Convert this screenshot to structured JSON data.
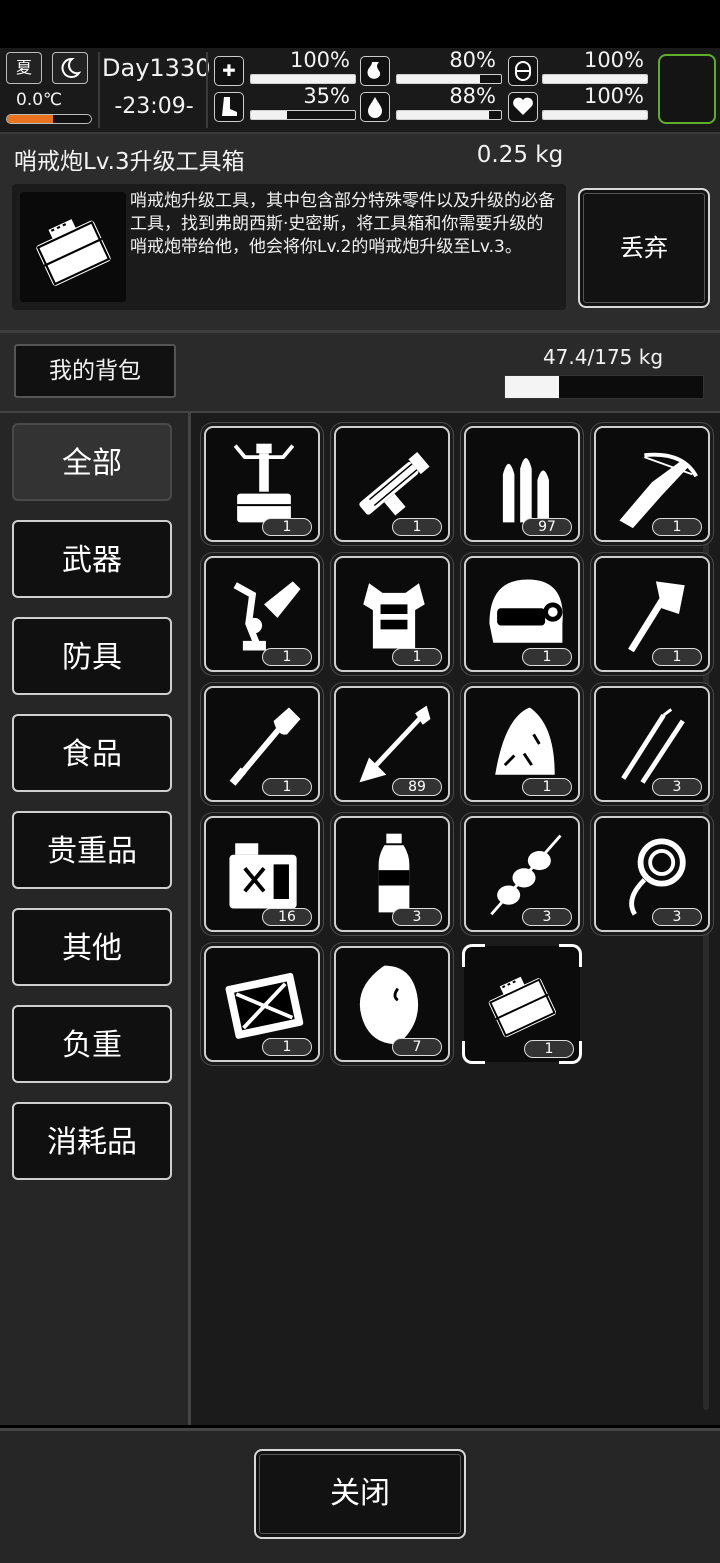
{
  "status": {
    "season": "夏",
    "temperature": "0.0℃",
    "temperature_level": 0.55,
    "day": "Day1330",
    "time": "-23:09-",
    "stats": [
      {
        "icon": "medkit-icon",
        "value": "100%",
        "level": 1.0
      },
      {
        "icon": "stomach-icon",
        "value": "80%",
        "level": 0.8
      },
      {
        "icon": "stamina-icon",
        "value": "100%",
        "level": 1.0
      },
      {
        "icon": "boot-icon",
        "value": "35%",
        "level": 0.35
      },
      {
        "icon": "water-drop-icon",
        "value": "88%",
        "level": 0.88
      },
      {
        "icon": "heart-icon",
        "value": "100%",
        "level": 1.0
      }
    ],
    "accent_color": "#5fae2a"
  },
  "detail": {
    "title": "哨戒炮Lv.3升级工具箱",
    "weight": "0.25 kg",
    "description": "哨戒炮升级工具，其中包含部分特殊零件以及升级的必备工具，找到弗朗西斯·史密斯，将工具箱和你需要升级的哨戒炮带给他，他会将你Lv.2的哨戒炮升级至Lv.3。",
    "discard_label": "丢弃"
  },
  "bag": {
    "title": "我的背包",
    "capacity": "47.4/175 kg",
    "capacity_fraction": 0.271
  },
  "categories": [
    "全部",
    "武器",
    "防具",
    "食品",
    "贵重品",
    "其他",
    "负重",
    "消耗品"
  ],
  "active_category": 0,
  "items": [
    {
      "icon": "sentry-turret-icon",
      "count": "1"
    },
    {
      "icon": "minigun-icon",
      "count": "1"
    },
    {
      "icon": "bullets-icon",
      "count": "97"
    },
    {
      "icon": "crossbow-icon",
      "count": "1"
    },
    {
      "icon": "mechanical-arm-icon",
      "count": "1"
    },
    {
      "icon": "armor-vest-icon",
      "count": "1"
    },
    {
      "icon": "helmet-icon",
      "count": "1"
    },
    {
      "icon": "axe-icon",
      "count": "1"
    },
    {
      "icon": "shovel-icon",
      "count": "1"
    },
    {
      "icon": "arrow-icon",
      "count": "89"
    },
    {
      "icon": "raw-meat-icon",
      "count": "1"
    },
    {
      "icon": "lockpick-icon",
      "count": "3"
    },
    {
      "icon": "fuel-can-icon",
      "count": "16"
    },
    {
      "icon": "water-bottle-icon",
      "count": "3"
    },
    {
      "icon": "kebab-icon",
      "count": "3"
    },
    {
      "icon": "rope-icon",
      "count": "3"
    },
    {
      "icon": "supply-crate-icon",
      "count": "1"
    },
    {
      "icon": "steak-icon",
      "count": "7"
    },
    {
      "icon": "toolbox-icon",
      "count": "1",
      "selected": true
    }
  ],
  "footer": {
    "close_label": "关闭"
  }
}
